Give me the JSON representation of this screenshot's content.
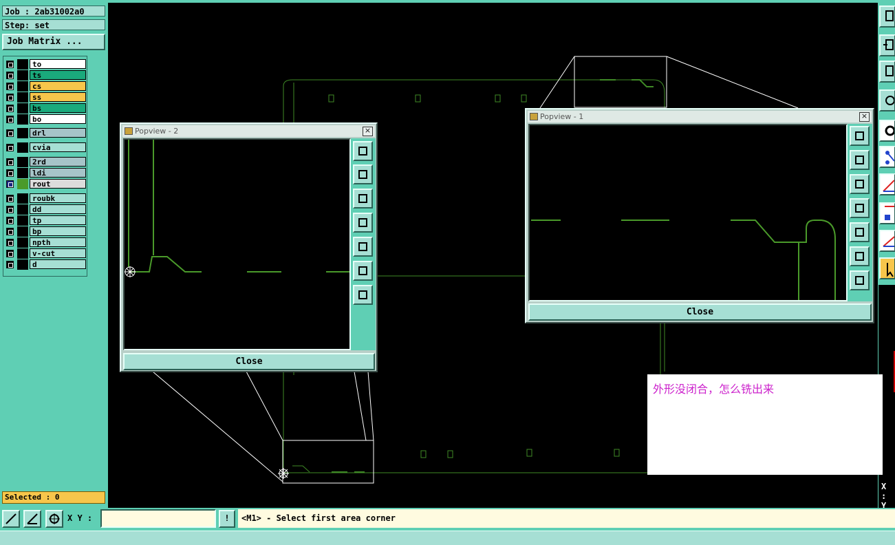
{
  "job": {
    "job_label": "Job : 2ab31002a0",
    "step_label": "Step: set",
    "matrix_button": "Job Matrix ..."
  },
  "layers": [
    {
      "name": "to",
      "color": "#ffffff"
    },
    {
      "name": "ts",
      "color": "#1aaa7c"
    },
    {
      "name": "cs",
      "color": "#f7c64b"
    },
    {
      "name": "ss",
      "color": "#f7c64b"
    },
    {
      "name": "bs",
      "color": "#1aaa7c"
    },
    {
      "name": "bo",
      "color": "#ffffff"
    },
    {
      "name": "drl",
      "color": "#a6c4c8"
    },
    {
      "name": "cvia",
      "color": "#a6dfd4"
    },
    {
      "name": "2rd",
      "color": "#a6c4c8"
    },
    {
      "name": "ldi",
      "color": "#a6c4c8"
    },
    {
      "name": "rout",
      "color": "#dcdcdc",
      "active": true
    },
    {
      "name": "roubk",
      "color": "#a6dfd4"
    },
    {
      "name": "dd",
      "color": "#a6dfd4"
    },
    {
      "name": "tp",
      "color": "#a6dfd4"
    },
    {
      "name": "bp",
      "color": "#a6dfd4"
    },
    {
      "name": "npth",
      "color": "#a6dfd4"
    },
    {
      "name": "v-cut",
      "color": "#a6dfd4"
    },
    {
      "name": "d",
      "color": "#a6dfd4"
    }
  ],
  "selected_label": "Selected : 0",
  "bottom": {
    "xy_label": "X Y :",
    "xy_value": "",
    "excl_label": "!",
    "message": "<M1> - Select first area corner"
  },
  "popview2": {
    "title": "Popview - 2",
    "close_label": "Close"
  },
  "popview1": {
    "title": "Popview - 1",
    "close_label": "Close"
  },
  "note_text": "外形没闭合，怎么铣出来",
  "xy_readout": {
    "x": "X :",
    "y": "Y :"
  },
  "colors": {
    "panel": "#5fcfb4",
    "trace": "#4a9a2a",
    "accent": "#f7c64b"
  }
}
